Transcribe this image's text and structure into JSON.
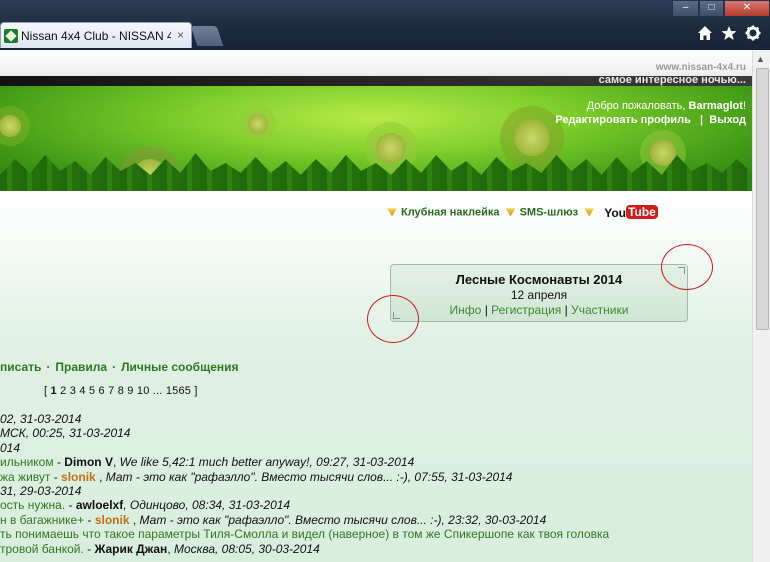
{
  "browser": {
    "tab_title": "Nissan 4x4 Club - NISSAN 4...",
    "tab_close": "×",
    "home_icon": "home-icon",
    "star_icon": "star-icon",
    "gear_icon": "gear-icon"
  },
  "header": {
    "url": "www.nissan-4x4.ru",
    "slogan": "самое интересное ночью...",
    "welcome_prefix": "Добро пожаловать, ",
    "username": "Barmaglot",
    "welcome_suffix": "!",
    "edit_profile": "Редактировать профиль",
    "separator": "|",
    "logout": "Выход"
  },
  "services": {
    "sticker": "Клубная наклейка",
    "sms": "SMS-шлюз",
    "youtube_you": "You",
    "youtube_tube": "Tube"
  },
  "event": {
    "title": "Лесные Космонавты 2014",
    "date": "12 апреля",
    "info": "Инфо",
    "registration": "Регистрация",
    "participants": "Участники",
    "sep": "|"
  },
  "nav": {
    "write": "писать",
    "rules": "Правила",
    "messages": "Личные сообщения",
    "dot": "·"
  },
  "pager": {
    "open": "[",
    "current": "1",
    "pages": [
      "2",
      "3",
      "4",
      "5",
      "6",
      "7",
      "8",
      "9",
      "10"
    ],
    "ellipsis": "...",
    "last": "1565",
    "close": "]"
  },
  "posts": [
    {
      "t1": "02, 31-03-2014"
    },
    {
      "t1": "МСК, 00:25, 31-03-2014"
    },
    {
      "t1": "014"
    },
    {
      "g": "ильником",
      "dash": "  - ",
      "author": "Dimon V",
      "sep": ", ",
      "quote": "We like 5,42:1 much better anyway!",
      "tail": ", 09:27, 31-03-2014"
    },
    {
      "g": "жа живут",
      "dash": "  - ",
      "oauthor": "slonik",
      "sep": " , ",
      "quote": "Мат - это как \"рафаэлло\". Вместо тысячи слов... :-)",
      "tail": ", 07:55, 31-03-2014"
    },
    {
      "t1": "31, 29-03-2014"
    },
    {
      "g": "ость нужна.",
      "dash": "  - ",
      "author": "awloelxf",
      "tail": ", Одинцово, 08:34, 31-03-2014"
    },
    {
      "g": "н в багажнике+",
      "dash": "  - ",
      "oauthor": "slonik",
      "sep": " , ",
      "quote": "Мат - это как \"рафаэлло\". Вместо тысячи слов... :-)",
      "tail": ", 23:32, 30-03-2014"
    },
    {
      "g": "ть понимаешь что такое параметры Тиля-Смолла и видел (наверное) в том же Спикершопе как твоя головка"
    },
    {
      "g": "тровой банкой.",
      "dash": "  - ",
      "author": "Жарик Джан",
      "tail": ", ",
      "city": "Москва",
      "time": ", 08:05, 30-03-2014"
    }
  ]
}
